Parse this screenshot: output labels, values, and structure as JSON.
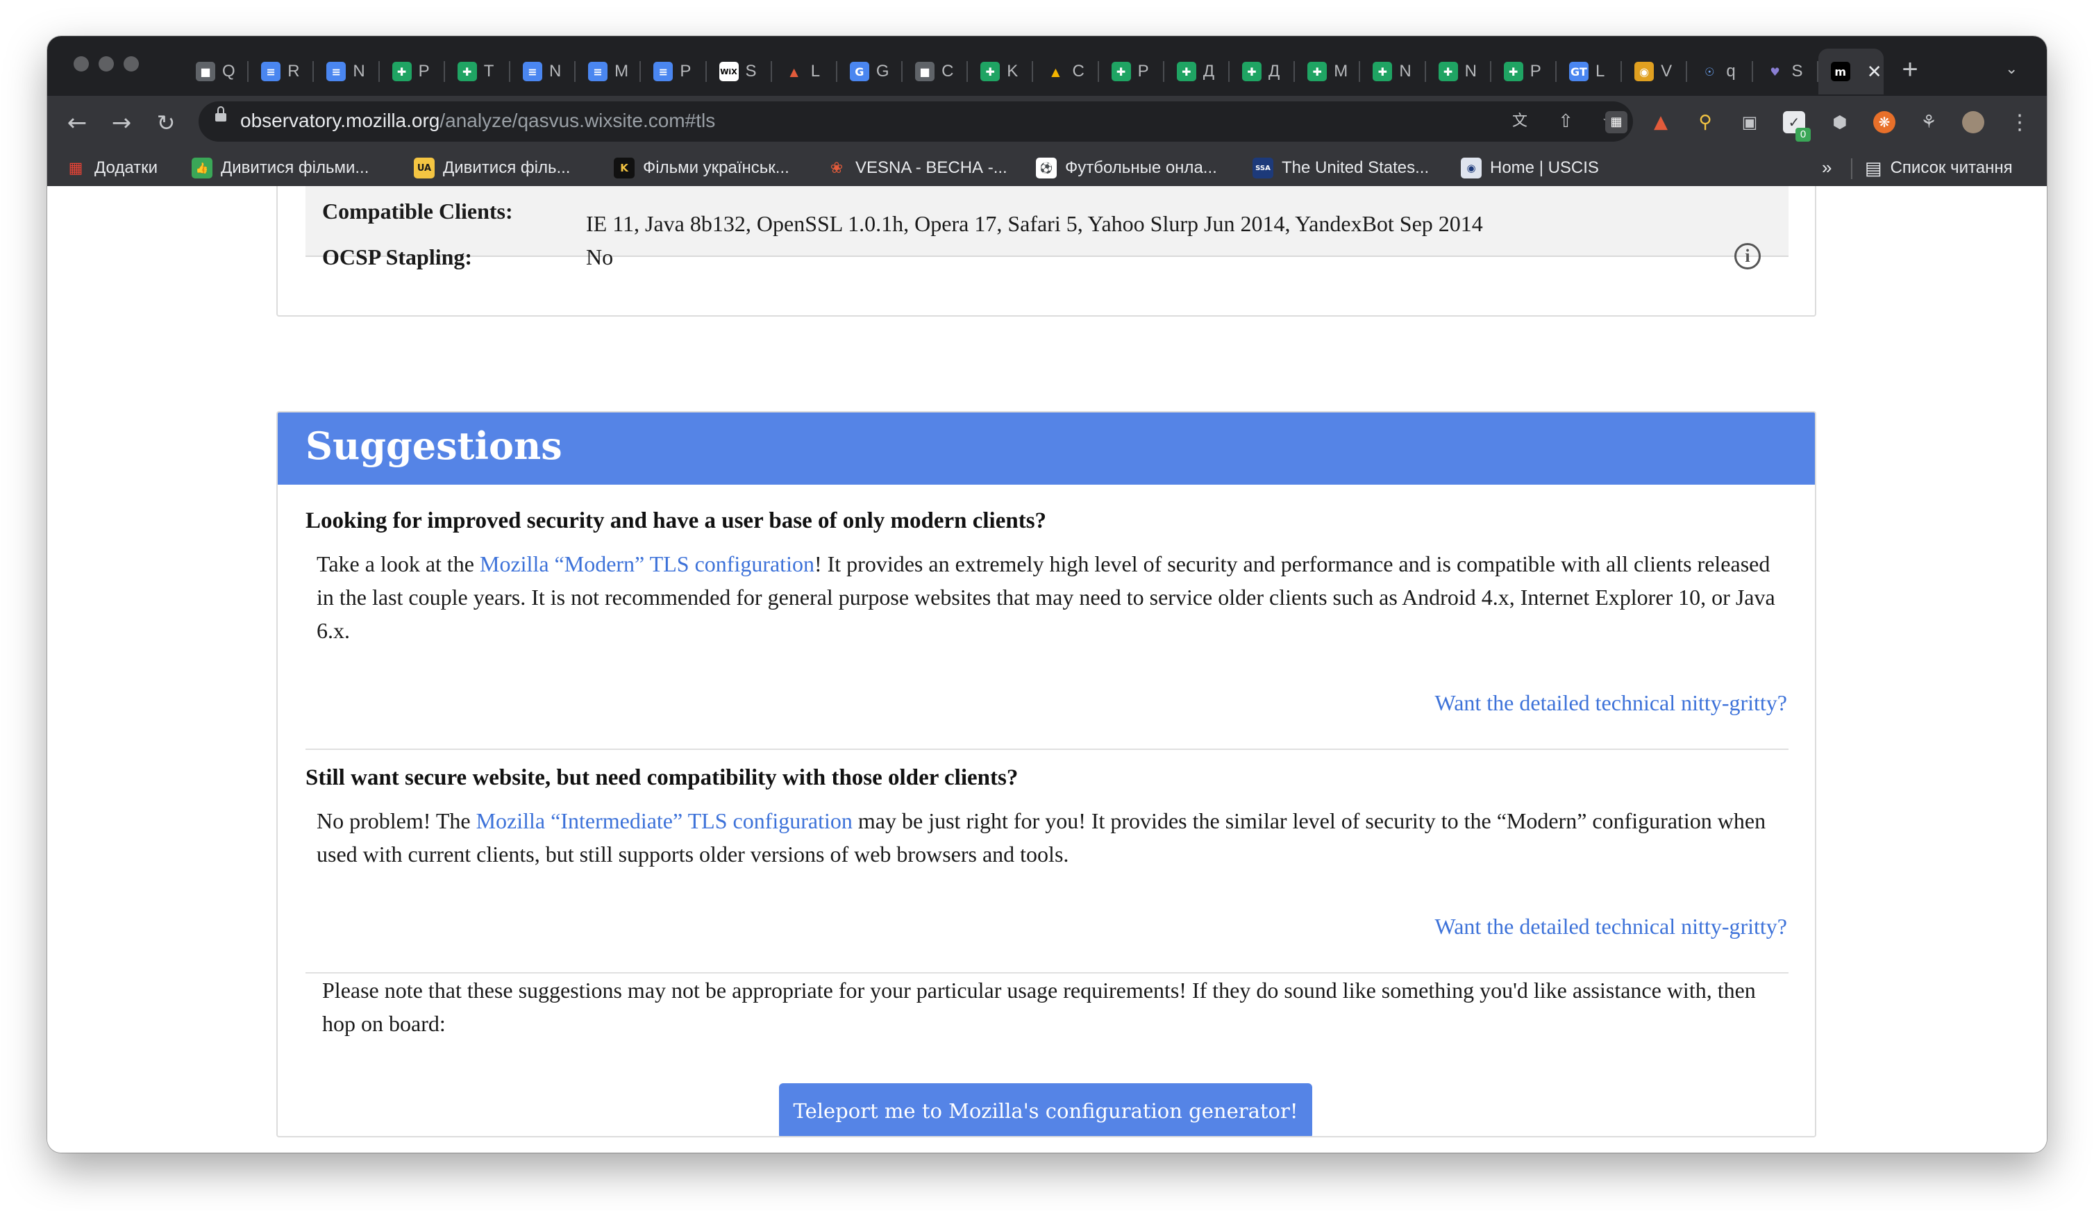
{
  "browser": {
    "tabs": [
      {
        "letter": "Q",
        "icon": "contact-icon"
      },
      {
        "letter": "R",
        "icon": "docs-icon"
      },
      {
        "letter": "N",
        "icon": "docs-icon"
      },
      {
        "letter": "P",
        "icon": "sheets-icon"
      },
      {
        "letter": "T",
        "icon": "sheets-icon"
      },
      {
        "letter": "N",
        "icon": "docs-icon"
      },
      {
        "letter": "M",
        "icon": "docs-icon"
      },
      {
        "letter": "P",
        "icon": "docs-icon"
      },
      {
        "letter": "S",
        "icon": "wix-icon"
      },
      {
        "letter": "L",
        "icon": "lighthouse-icon"
      },
      {
        "letter": "G",
        "icon": "translate-icon"
      },
      {
        "letter": "C",
        "icon": "contact-icon"
      },
      {
        "letter": "K",
        "icon": "sheets-icon"
      },
      {
        "letter": "C",
        "icon": "drive-icon"
      },
      {
        "letter": "P",
        "icon": "sheets-icon"
      },
      {
        "letter": "Д",
        "icon": "sheets-icon"
      },
      {
        "letter": "Д",
        "icon": "sheets-icon"
      },
      {
        "letter": "M",
        "icon": "sheets-icon"
      },
      {
        "letter": "N",
        "icon": "sheets-icon"
      },
      {
        "letter": "N",
        "icon": "sheets-icon"
      },
      {
        "letter": "P",
        "icon": "sheets-icon"
      },
      {
        "letter": "L",
        "icon": "gt-icon"
      },
      {
        "letter": "V",
        "icon": "chrome-icon"
      },
      {
        "letter": "q",
        "icon": "compass-icon"
      },
      {
        "letter": "S",
        "icon": "hands-icon"
      },
      {
        "letter": "",
        "icon": "mdn-icon",
        "active": true
      }
    ],
    "new_tab": "+",
    "address": {
      "host": "observatory.mozilla.org",
      "path": "/analyze/qasvus.wixsite.com#tls"
    },
    "bookmarks": [
      {
        "label": "Додатки",
        "icon": "apps-grid-icon"
      },
      {
        "label": "Дивитися фільми...",
        "icon": "thumb-up-icon"
      },
      {
        "label": "Дивитися філь...",
        "icon": "ua-popcorn-icon"
      },
      {
        "label": "Фільми українськ...",
        "icon": "k-icon"
      },
      {
        "label": "VESNA - ВЕСНА -...",
        "icon": "vesna-icon"
      },
      {
        "label": "Футбольные онла...",
        "icon": "football-icon"
      },
      {
        "label": "The United States...",
        "icon": "ssa-icon"
      },
      {
        "label": "Home | USCIS",
        "icon": "uscis-icon"
      }
    ],
    "bookmarks_more": "»",
    "reading_list": "Список читання",
    "extension_badge": "0"
  },
  "tls_table": {
    "compatible_label": "Compatible Clients:",
    "compatible_value": "IE 11, Java 8b132, OpenSSL 1.0.1h, Opera 17, Safari 5, Yahoo Slurp Jun 2014, YandexBot Sep 2014",
    "ocsp_label": "OCSP Stapling:",
    "ocsp_value": "No"
  },
  "suggestions": {
    "title": "Suggestions",
    "modern": {
      "question": "Looking for improved security and have a user base of only modern clients?",
      "text_before": "Take a look at the ",
      "link": "Mozilla “Modern” TLS configuration",
      "text_after": "! It provides an extremely high level of security and performance and is compatible with all clients released in the last couple years. It is not recommended for general purpose websites that may need to service older clients such as Android 4.x, Internet Explorer 10, or Java 6.x.",
      "details_link": "Want the detailed technical nitty-gritty?"
    },
    "intermediate": {
      "question": "Still want secure website, but need compatibility with those older clients?",
      "text_before": "No problem! The ",
      "link": "Mozilla “Intermediate” TLS configuration",
      "text_after": " may be just right for you! It provides the similar level of security to the “Modern” configuration when used with current clients, but still supports older versions of web browsers and tools.",
      "details_link": "Want the detailed technical nitty-gritty?"
    },
    "note": "Please note that these suggestions may not be appropriate for your particular usage requirements! If they do sound like something you'd like assistance with, then hop on board:",
    "cta_button": "Teleport me to Mozilla's configuration generator!"
  },
  "colors": {
    "accent": "#5584e6",
    "link": "#3d72d9",
    "chrome_dark": "#202124",
    "chrome_toolbar": "#35363a"
  }
}
